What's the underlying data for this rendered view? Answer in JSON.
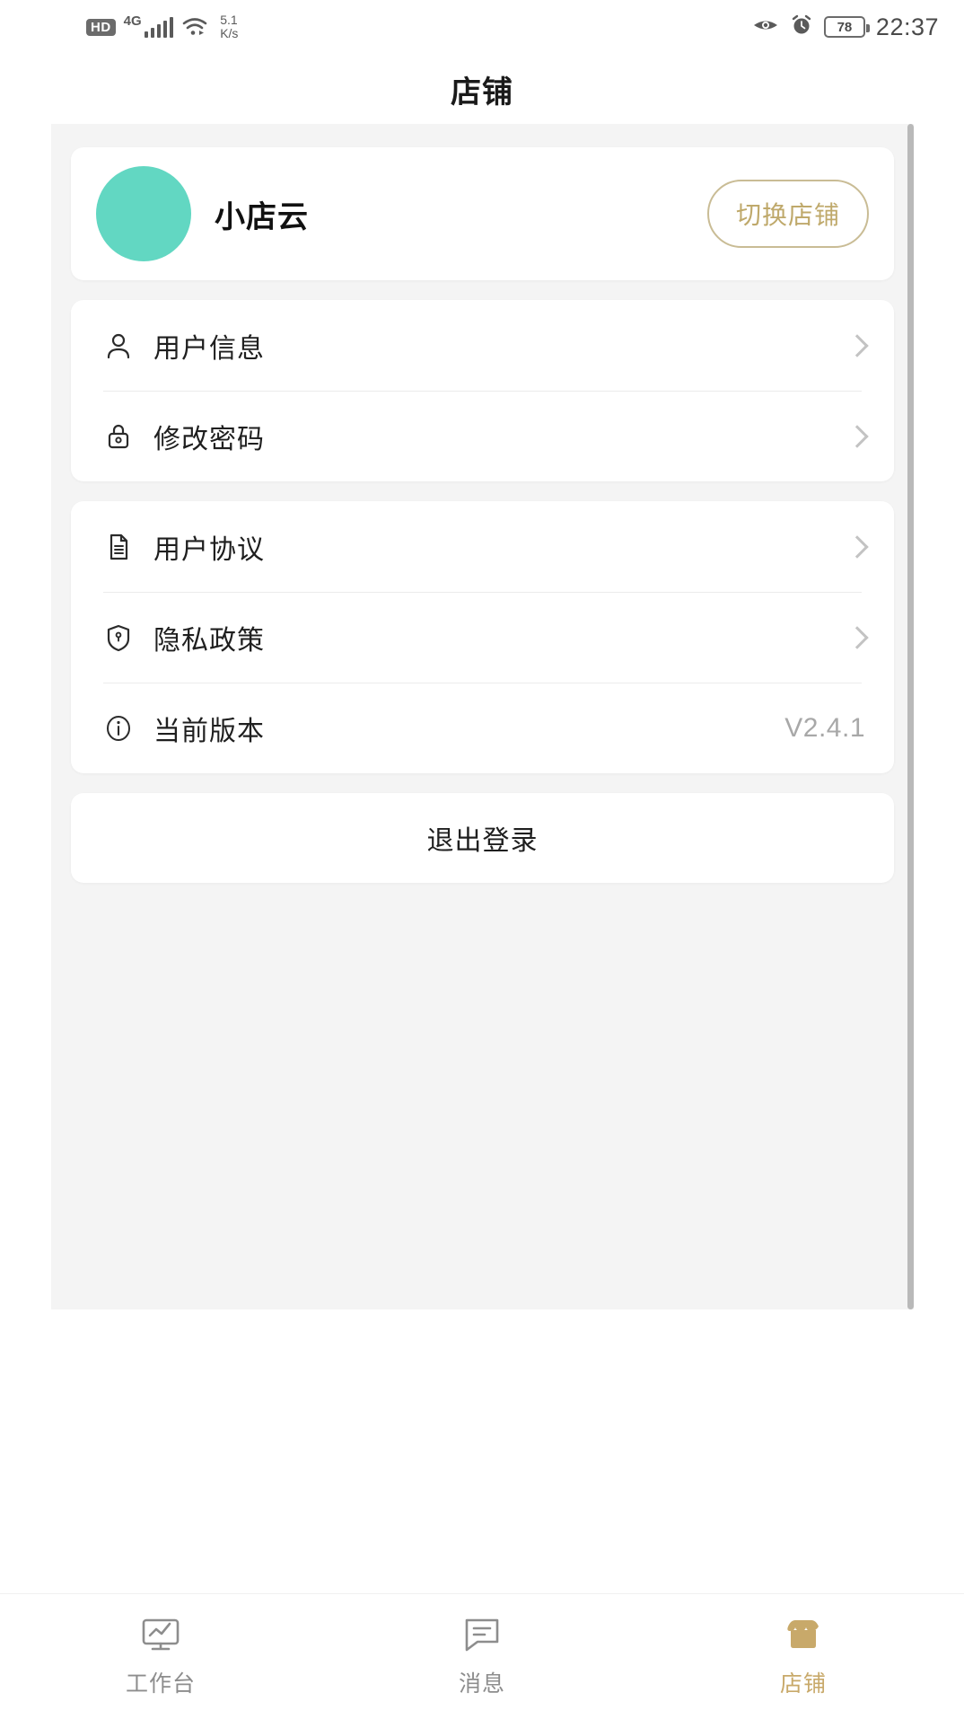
{
  "statusbar": {
    "hd_label": "HD",
    "network_type": "4G",
    "speed_value": "5.1",
    "speed_unit": "K/s",
    "battery_percent": "78",
    "time": "22:37",
    "icons": [
      "hd-badge",
      "signal-bars-icon",
      "wifi-icon",
      "eye-icon",
      "alarm-clock-icon",
      "battery-icon"
    ]
  },
  "header": {
    "title": "店铺"
  },
  "profile": {
    "shop_name": "小店云",
    "switch_shop_label": "切换店铺",
    "avatar_color": "#62d7c2",
    "accent_color": "#bfa96b"
  },
  "account_group": {
    "items": [
      {
        "label": "用户信息",
        "icon": "user-icon"
      },
      {
        "label": "修改密码",
        "icon": "lock-icon"
      }
    ]
  },
  "info_group": {
    "items": [
      {
        "label": "用户协议",
        "icon": "document-icon",
        "value": ""
      },
      {
        "label": "隐私政策",
        "icon": "shield-icon",
        "value": ""
      },
      {
        "label": "当前版本",
        "icon": "info-icon",
        "value": "V2.4.1"
      }
    ]
  },
  "logout": {
    "label": "退出登录"
  },
  "tabbar": {
    "items": [
      {
        "label": "工作台",
        "icon": "workbench-icon",
        "active": false
      },
      {
        "label": "消息",
        "icon": "message-icon",
        "active": false
      },
      {
        "label": "店铺",
        "icon": "store-icon",
        "active": true
      }
    ],
    "active_color": "#c8a96a",
    "inactive_color": "#8d8d8d"
  }
}
